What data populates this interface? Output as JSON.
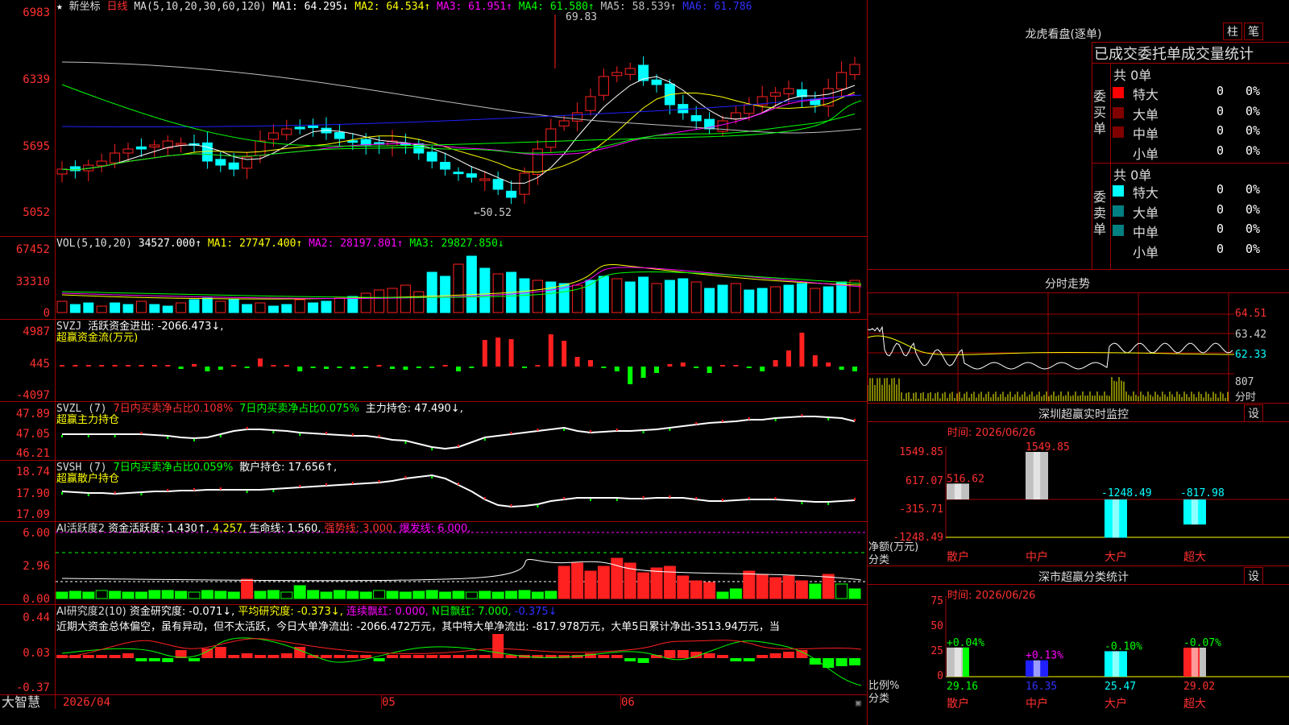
{
  "colors": {
    "up": "#ff2020",
    "down": "#00ffff",
    "ma1": "#ffffff",
    "ma2": "#ffff00",
    "ma3": "#ff00ff",
    "ma4": "#00ff00",
    "ma5": "#c0c0c0",
    "ma6": "#2020ff",
    "grid": "#a00000",
    "green": "#00ff00"
  },
  "main": {
    "star": "★",
    "title": "新坐标",
    "period": "日线",
    "ma_label": "MA(5,10,20,30,60,120)",
    "ma1": "MA1: 64.295↓",
    "ma2": "MA2: 64.534↑",
    "ma3": "MA3: 61.951↑",
    "ma4": "MA4: 61.580↑",
    "ma5": "MA5: 58.539↑",
    "ma6": "MA6: 61.786",
    "y_ticks": [
      "6983",
      "6339",
      "5695",
      "5052"
    ],
    "high_mark": "69.83",
    "low_mark": "←50.52"
  },
  "vol": {
    "label": "VOL(5,10,20)",
    "v": "34527.000↑",
    "ma1": "MA1: 27747.400↑",
    "ma2": "MA2: 28197.801↑",
    "ma3": "MA3: 29827.850↓",
    "y_ticks": [
      "67452",
      "33310",
      "0"
    ]
  },
  "svzj": {
    "label": "SVZJ",
    "text": "活跃资金进出: -2066.473↓,",
    "sub": "超赢资金流(万元)",
    "y_ticks": [
      "4987",
      "445",
      "-4097"
    ]
  },
  "svzl": {
    "label": "SVZL (7)",
    "t1": "7日内买卖净占比0.108%",
    "t2": "7日内买卖净占比0.075%",
    "t3": "主力持仓: 47.490↓,",
    "sub": "超赢主力持仓",
    "y_ticks": [
      "47.89",
      "47.05",
      "46.21"
    ]
  },
  "svsh": {
    "label": "SVSH (7)",
    "t1": "7日内买卖净占比0.059%",
    "t2": "散户持仓: 17.656↑,",
    "sub": "超赢散户持仓",
    "y_ticks": [
      "18.74",
      "17.90",
      "17.09"
    ]
  },
  "ai1": {
    "label": "AI活跃度2",
    "t1": "资金活跃度: 1.430↑,",
    "t2": "4.257,",
    "t3": "生命线: 1.560,",
    "t4": "强势线: 3.000,",
    "t5": "爆发线: 6.000,",
    "y_ticks": [
      "6.00",
      "2.96",
      "0.00"
    ]
  },
  "ai2": {
    "label": "AI研究度2(10)",
    "t1": "资金研究度: -0.071↓,",
    "t2": "平均研究度: -0.373↓,",
    "t3": "连续飘红: 0.000,",
    "t4": "N日飘红: 7.000,",
    "t5": "-0.375↓",
    "desc": "近期大资金总体偏空，虽有异动，但不太活跃，今日大单净流出: -2066.472万元，其中特大单净流出: -817.978万元，大单5日累计净出-3513.94万元，当",
    "y_ticks": [
      "0.44",
      "0.03",
      "-0.37"
    ]
  },
  "footer": {
    "app": "大智慧",
    "dates": [
      "2026/04",
      "05",
      "06"
    ]
  },
  "right": {
    "dragon_title": "龙虎看盘(逐单)",
    "btn_zhu": "柱",
    "btn_bi": "笔",
    "stats_title": "已成交委托单成交量统计",
    "buy_side": "委买单",
    "sell_side": "委卖单",
    "buy_total": "共 0单",
    "sell_total": "共 0单",
    "rows": [
      {
        "name": "特大",
        "qty": "0",
        "pct": "0%"
      },
      {
        "name": "大单",
        "qty": "0",
        "pct": "0%"
      },
      {
        "name": "中单",
        "qty": "0",
        "pct": "0%"
      },
      {
        "name": "小单",
        "qty": "0",
        "pct": "0%"
      }
    ],
    "fenshi_title": "分时走势",
    "fenshi_y": [
      "64.51",
      "63.42",
      "62.33",
      "807",
      "分时"
    ],
    "monitor_title": "深圳超赢实时监控",
    "monitor_time": "时间: 2026/06/26",
    "monitor_y": [
      "1549.85",
      "617.07",
      "-315.71",
      "-1248.49"
    ],
    "monitor_vals": [
      "516.62",
      "1549.85",
      "-1248.49",
      "-817.98"
    ],
    "monitor_unit": "净额(万元)",
    "monitor_cls": "分类",
    "cats": [
      "散户",
      "中户",
      "大户",
      "超大"
    ],
    "btn_set": "设",
    "stat_title": "深市超赢分类统计",
    "stat_time": "时间: 2026/06/26",
    "stat_y": [
      "75",
      "50",
      "25",
      "0"
    ],
    "stat_pct": [
      "+0.04%",
      "+0.13%",
      "-0.10%",
      "-0.07%"
    ],
    "stat_vals": [
      "29.16",
      "16.35",
      "25.47",
      "29.02"
    ],
    "stat_unit": "比例%",
    "stat_cls": "分类"
  }
}
